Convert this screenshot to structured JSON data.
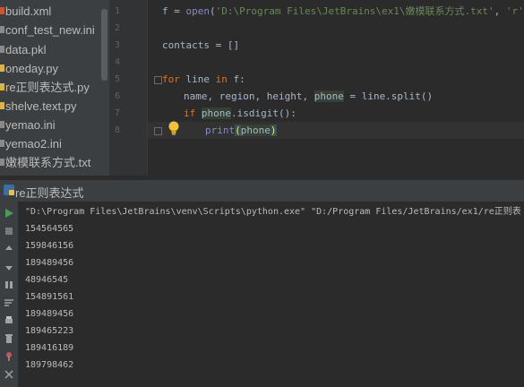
{
  "project_tree": {
    "files": [
      {
        "name": "build.xml",
        "icon": "xml-file-icon",
        "color": "#cc5533"
      },
      {
        "name": "conf_test_new.ini",
        "icon": "ini-file-icon",
        "color": "#8a8a8a"
      },
      {
        "name": "data.pkl",
        "icon": "generic-file-icon",
        "color": "#8a8a8a"
      },
      {
        "name": "oneday.py",
        "icon": "python-file-icon",
        "color": "#d9b44a"
      },
      {
        "name": "re正则表达式.py",
        "icon": "python-file-icon",
        "color": "#d9b44a"
      },
      {
        "name": "shelve.text.py",
        "icon": "python-file-icon",
        "color": "#d9b44a"
      },
      {
        "name": "yemao.ini",
        "icon": "ini-file-icon",
        "color": "#8a8a8a"
      },
      {
        "name": "yemao2.ini",
        "icon": "ini-file-icon",
        "color": "#8a8a8a"
      },
      {
        "name": "嫩模联系方式.txt",
        "icon": "text-file-icon",
        "color": "#8a8a8a"
      }
    ]
  },
  "editor": {
    "line_numbers": [
      "1",
      "2",
      "3",
      "4",
      "5",
      "6",
      "7",
      "8"
    ],
    "code": {
      "l1_var": "f = ",
      "l1_func": "open",
      "l1_paren": "(",
      "l1_path": "'D:\\Program Files\\JetBrains\\ex1\\嫩模联系方式.txt'",
      "l1_comma": ", ",
      "l1_mode": "'r'",
      "l1_close": ")",
      "l3": "contacts = []",
      "l5_for": "for",
      "l5_line": " line ",
      "l5_in": "in",
      "l5_rest": " f:",
      "l6_a": "name, region, height, ",
      "l6_phone": "phone",
      "l6_b": " = line.split()",
      "l7_if": "if",
      "l7_phone": "phone",
      "l7_rest": ".isdigit():",
      "l8_print": "print",
      "l8_open": "(",
      "l8_arg": "phone",
      "l8_close": ")"
    }
  },
  "run_window": {
    "tab_label": "re正则表达式",
    "command": "\"D:\\Program Files\\JetBrains\\venv\\Scripts\\python.exe\" \"D:/Program Files/JetBrains/ex1/re正则表",
    "output_lines": [
      "154564565",
      "159846156",
      "189489456",
      "48946545",
      "154891561",
      "189489456",
      "189465223",
      "189416189",
      "189798462"
    ]
  },
  "colors": {
    "keyword": "#cc7832",
    "string": "#6a8759",
    "builtin": "#8888c6",
    "text": "#a9b7c6",
    "panel": "#3c3f41",
    "editor_bg": "#2b2b2b"
  }
}
